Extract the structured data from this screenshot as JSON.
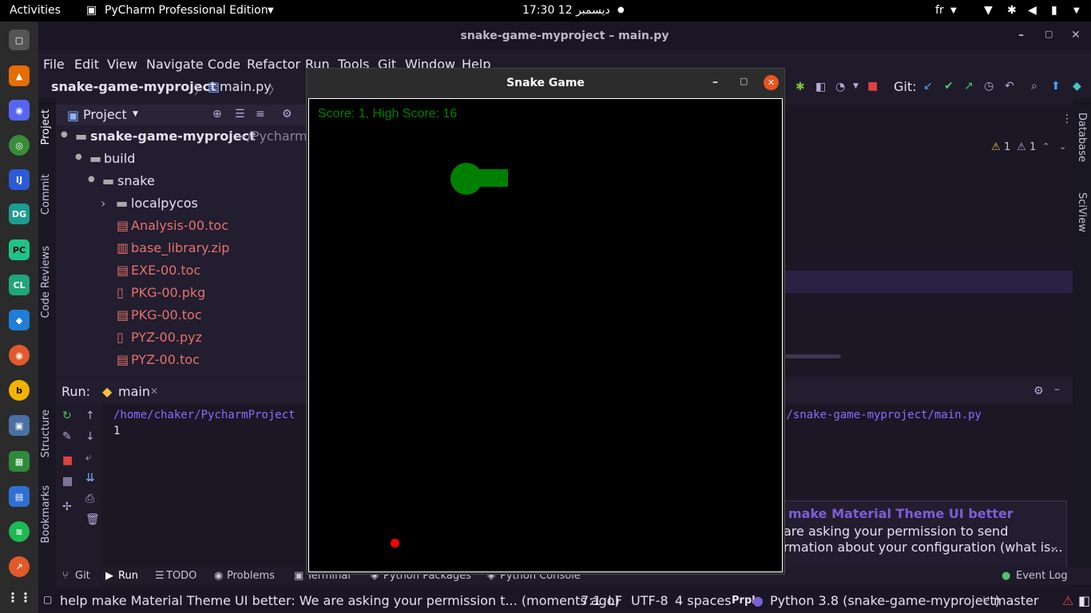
{
  "topbar": {
    "activities": "Activities",
    "app_name": "PyCharm Professional Edition",
    "clock": "17:30  12 ديسمبر",
    "lang": "fr"
  },
  "pycharm": {
    "title": "snake-game-myproject – main.py",
    "menu": [
      "File",
      "Edit",
      "View",
      "Navigate",
      "Code",
      "Refactor",
      "Run",
      "Tools",
      "Git",
      "Window",
      "Help"
    ],
    "breadcrumb_project": "snake-game-myproject",
    "breadcrumb_file": "main.py",
    "git_label": "Git:",
    "project_panel_title": "Project",
    "tree": {
      "root": "snake-game-myproject",
      "root_path": "~/PycharmP",
      "build": "build",
      "snake": "snake",
      "localpycos": "localpycos",
      "files": [
        "Analysis-00.toc",
        "base_library.zip",
        "EXE-00.toc",
        "PKG-00.pkg",
        "PKG-00.toc",
        "PYZ-00.pyz",
        "PYZ-00.toc"
      ]
    },
    "warnings": {
      "a": "1",
      "b": "1"
    },
    "run": {
      "label": "Run:",
      "tab": "main",
      "path_left": "/home/chaker/PycharmProject",
      "path_right": "s/snake-game-myproject/main.py",
      "output": "1"
    },
    "notification": {
      "title": "make Material Theme UI better",
      "line1": "are asking your permission to send",
      "line2": "rmation about your configuration (what is..."
    },
    "bottom_tabs": [
      "Git",
      "Run",
      "TODO",
      "Problems",
      "Terminal",
      "Python Packages",
      "Python Console"
    ],
    "event_log": "Event Log",
    "status": {
      "message": "help make Material Theme UI better: We are asking your permission t... (moments ago)",
      "position": "7:1",
      "line_sep": "LF",
      "encoding": "UTF-8",
      "indent": "4 spaces",
      "prpl": "Prpl",
      "interpreter": "Python 3.8 (snake-game-myproject)",
      "branch": "master"
    },
    "left_tabs": [
      "Project",
      "Commit",
      "Code Reviews",
      "Structure",
      "Bookmarks"
    ],
    "right_tabs": [
      "Database",
      "SciView"
    ]
  },
  "snake_game": {
    "title": "Snake Game",
    "score_text": "Score: 1, High Score: 16",
    "colors": {
      "snake": "#008000",
      "food": "#ff0000",
      "bg": "#000000",
      "score": "#008000"
    }
  }
}
